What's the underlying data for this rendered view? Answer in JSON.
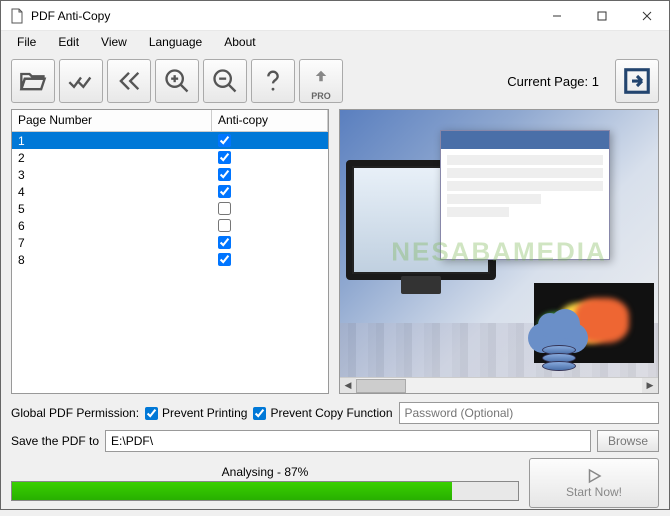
{
  "window": {
    "title": "PDF Anti-Copy"
  },
  "menu": {
    "file": "File",
    "edit": "Edit",
    "view": "View",
    "language": "Language",
    "about": "About"
  },
  "toolbar": {
    "current_page_label": "Current Page: 1",
    "pro_label": "PRO"
  },
  "table": {
    "header_page": "Page Number",
    "header_anticopy": "Anti-copy",
    "rows": [
      {
        "page": "1",
        "checked": true,
        "selected": true
      },
      {
        "page": "2",
        "checked": true,
        "selected": false
      },
      {
        "page": "3",
        "checked": true,
        "selected": false
      },
      {
        "page": "4",
        "checked": true,
        "selected": false
      },
      {
        "page": "5",
        "checked": false,
        "selected": false
      },
      {
        "page": "6",
        "checked": false,
        "selected": false
      },
      {
        "page": "7",
        "checked": true,
        "selected": false
      },
      {
        "page": "8",
        "checked": true,
        "selected": false
      }
    ]
  },
  "watermark": "NESABAMEDIA",
  "permissions": {
    "label": "Global PDF Permission:",
    "prevent_printing_label": "Prevent Printing",
    "prevent_printing_checked": true,
    "prevent_copy_label": "Prevent Copy Function",
    "prevent_copy_checked": true,
    "password_placeholder": "Password (Optional)",
    "password_value": ""
  },
  "save": {
    "label": "Save the PDF to",
    "path": "E:\\PDF\\",
    "browse": "Browse"
  },
  "progress": {
    "label": "Analysing - 87%",
    "percent": 87
  },
  "start": {
    "label": "Start Now!"
  }
}
